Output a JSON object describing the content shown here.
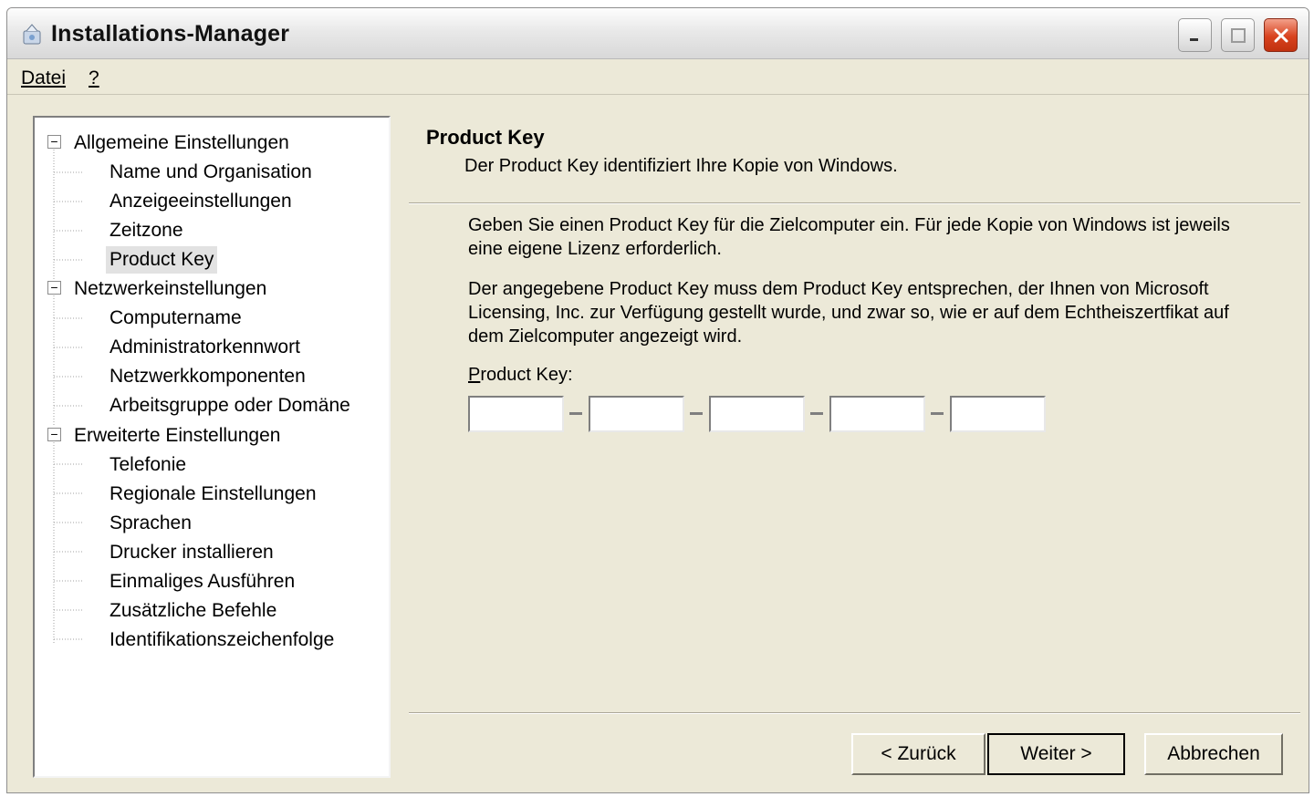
{
  "window": {
    "title": "Installations-Manager"
  },
  "menu": {
    "datei": "Datei",
    "help": "?"
  },
  "tree": {
    "groups": [
      {
        "label": "Allgemeine Einstellungen",
        "expanded": true,
        "items": [
          "Name und Organisation",
          "Anzeigeeinstellungen",
          "Zeitzone",
          "Product Key"
        ]
      },
      {
        "label": "Netzwerkeinstellungen",
        "expanded": true,
        "items": [
          "Computername",
          "Administratorkennwort",
          "Netzwerkkomponenten",
          "Arbeitsgruppe oder Domäne"
        ]
      },
      {
        "label": "Erweiterte Einstellungen",
        "expanded": true,
        "items": [
          "Telefonie",
          "Regionale Einstellungen",
          "Sprachen",
          "Drucker installieren",
          "Einmaliges Ausführen",
          "Zusätzliche Befehle",
          "Identifikationszeichenfolge"
        ]
      }
    ],
    "selected": "Product Key"
  },
  "panel": {
    "title": "Product Key",
    "subtitle": "Der Product Key identifiziert Ihre Kopie von Windows.",
    "paragraph1": "Geben Sie einen Product Key für die Zielcomputer ein. Für jede Kopie von Windows ist jeweils eine eigene Lizenz erforderlich.",
    "paragraph2": "Der angegebene Product Key muss dem Product Key entsprechen, der Ihnen von Microsoft Licensing, Inc. zur Verfügung gestellt wurde, und zwar so, wie er auf dem Echtheiszertfikat auf dem Zielcomputer angezeigt wird.",
    "pk_label": "Product Key:",
    "pk_fields": [
      "",
      "",
      "",
      "",
      ""
    ]
  },
  "buttons": {
    "back": "< Zurück",
    "next": "Weiter >",
    "cancel": "Abbrechen"
  },
  "colors": {
    "window_bg": "#ece9d8",
    "close_button": "#d8421e",
    "selection_bg": "#e2e2e2"
  },
  "icons": {
    "app": "installer-icon",
    "minimize": "minimize-icon",
    "maximize": "maximize-icon",
    "close": "close-icon"
  }
}
